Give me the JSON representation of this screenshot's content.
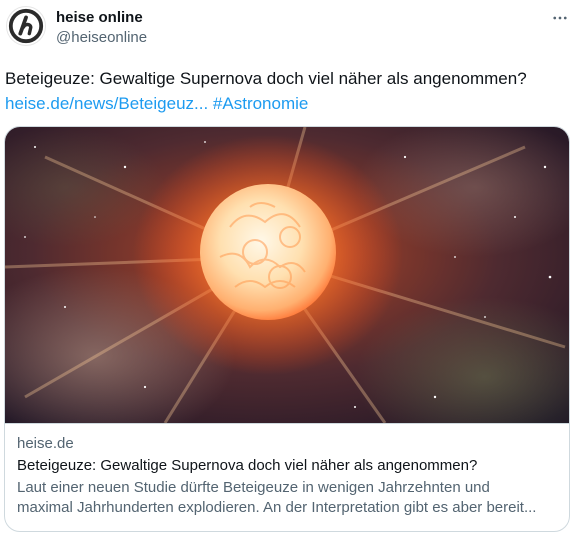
{
  "author": {
    "display_name": "heise online",
    "handle": "@heiseonline",
    "avatar_icon": "heise-logo-icon"
  },
  "tweet": {
    "text": "Beteigeuze: Gewaltige Supernova doch viel näher als angenommen?",
    "link_label": "heise.de/news/Beteigeuz...",
    "hashtag": "#Astronomie"
  },
  "card": {
    "domain": "heise.de",
    "title": "Beteigeuze: Gewaltige Supernova doch viel näher als angenommen?",
    "description_line1": "Laut einer neuen Studie dürfte Beteigeuze in wenigen Jahrzehnten und",
    "description_line2": "maximal Jahrhunderten explodieren. An der Interpretation gibt es aber bereit..."
  },
  "colors": {
    "link": "#1d9bf0",
    "text": "#0f1419",
    "secondary": "#536471",
    "border": "#cfd9de"
  }
}
